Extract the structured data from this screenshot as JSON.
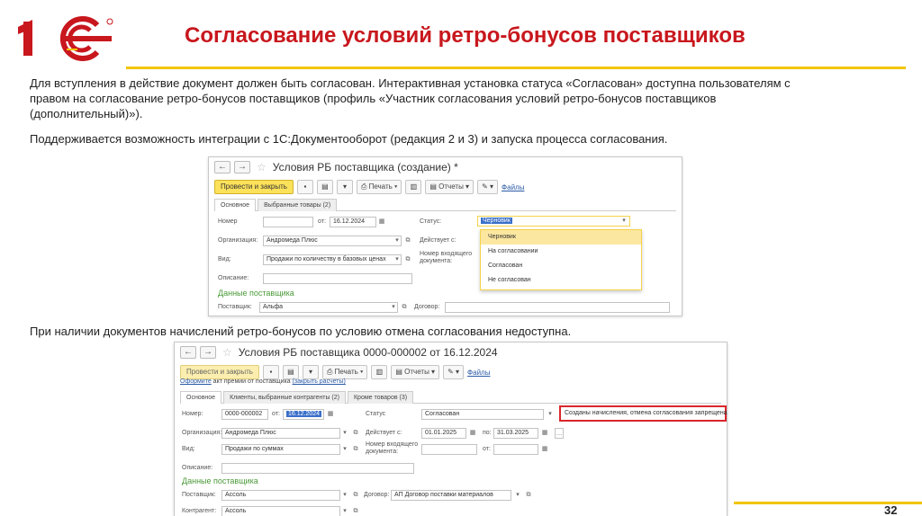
{
  "header": {
    "title": "Согласование условий ретро-бонусов поставщиков",
    "logo_text": "1С"
  },
  "paragraphs": {
    "p1": "Для вступления в действие документ должен быть согласован. Интерактивная установка статуса «Согласован» доступна пользователям с правом на согласование ретро-бонусов поставщиков (профиль «Участник согласования условий ретро-бонусов поставщиков (дополнительный)»).",
    "p2": "Поддерживается возможность интеграции с 1С:Документооборот (редакция 2 и 3) и запуска процесса согласования.",
    "p3": "При наличии документов начислений ретро-бонусов по условию отмена согласования недоступна."
  },
  "win1": {
    "title": "Условия РБ поставщика (создание) *",
    "toolbar": {
      "post_close": "Провести и закрыть",
      "print": "Печать",
      "reports": "Отчеты",
      "files": "Файлы"
    },
    "tabs": [
      "Основное",
      "Выбранные товары (2)"
    ],
    "fields": {
      "number_label": "Номер",
      "number_value": "",
      "date_label": "от:",
      "date_value": "16.12.2024",
      "status_label": "Статус:",
      "status_value": "Черновик",
      "org_label": "Организация:",
      "org_value": "Андромеда Плюс",
      "valid_label": "Действует с:",
      "type_label": "Вид:",
      "type_value": "Продажи по количеству в базовых ценах",
      "incoming_label": "Номер входящего документа:",
      "desc_label": "Описание:",
      "supplier_section": "Данные поставщика",
      "supplier_label": "Поставщик:",
      "supplier_value": "Альфа",
      "contract_label": "Договор:"
    },
    "dropdown": [
      "Черновик",
      "На согласовании",
      "Согласован",
      "Не согласован"
    ]
  },
  "win2": {
    "title": "Условия РБ поставщика 0000-000002 от 16.12.2024",
    "toolbar": {
      "post_close": "Провести и закрыть",
      "print": "Печать",
      "reports": "Отчеты",
      "files": "Файлы"
    },
    "info_link": "Оформите",
    "info_text": " акт премии от поставщика ",
    "info_link2": "(закрыть расчеты)",
    "tabs": [
      "Основное",
      "Клиенты, выбранные контрагенты (2)",
      "Кроме товаров (3)"
    ],
    "fields": {
      "number_label": "Номер:",
      "number_value": "0000-000002",
      "date_label": "от:",
      "date_value": "16.12.2024",
      "status_label": "Статус",
      "status_value": "Согласован",
      "status_note": "Созданы начисления, отмена согласования запрещена",
      "org_label": "Организация:",
      "org_value": "Андромеда Плюс",
      "valid_label": "Действует с:",
      "valid_from": "01.01.2025",
      "valid_to_label": "по:",
      "valid_to": "31.03.2025",
      "type_label": "Вид:",
      "type_value": "Продажи по суммах",
      "incoming_label": "Номер входящего документа:",
      "incoming_date_label": "от:",
      "desc_label": "Описание:",
      "supplier_section": "Данные поставщика",
      "supplier_label": "Поставщик:",
      "supplier_value": "Ассоль",
      "contract_label": "Договор:",
      "contract_value": "АП Договор поставки материалов",
      "counterparty_label": "Контрагент:",
      "counterparty_value": "Ассоль"
    }
  },
  "footer": {
    "page_number": "32"
  },
  "colors": {
    "title_red": "#c8171d",
    "accent_yellow": "#f2c500",
    "section_green": "#4a9a38",
    "highlight_red": "#d9262b"
  }
}
